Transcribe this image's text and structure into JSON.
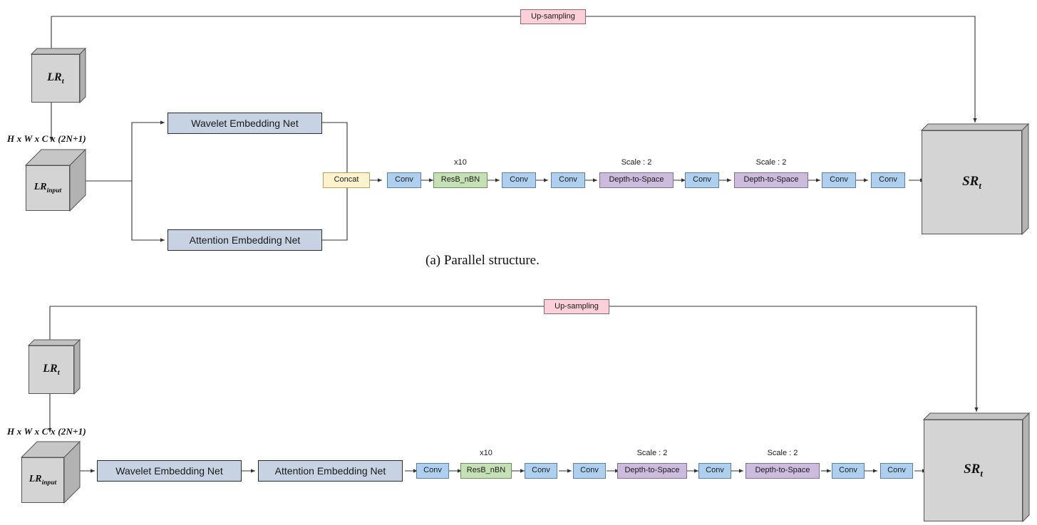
{
  "figure": {
    "caption_a": "(a) Parallel structure.",
    "dim_label": "H x W x C x (2N+1)"
  },
  "colors": {
    "embedding_net": "#c7d3e3",
    "conv": "#aed0ee",
    "resb": "#c5e0b4",
    "concat": "#fdf3ce",
    "depth_to_space": "#ccbbdd",
    "upsampling": "#fccfd9",
    "tensor": "#d4d4d4",
    "line": "#333333"
  },
  "labels": {
    "lr_t": "LR",
    "lr_t_sub": "t",
    "lr_input": "LR",
    "lr_input_sub": "input",
    "sr_t": "SR",
    "sr_t_sub": "t",
    "upsampling": "Up-sampling",
    "concat": "Concat",
    "conv": "Conv",
    "resb": "ResB_nBN",
    "depth_to_space": "Depth-to-Space",
    "wavelet_net": "Wavelet Embedding Net",
    "attention_net": "Attention Embedding Net",
    "resb_repeat": "x10",
    "scale": "Scale : 2"
  },
  "parallel_structure": {
    "branches": [
      {
        "label": "Wavelet Embedding Net"
      },
      {
        "label": "Attention Embedding Net"
      }
    ],
    "pipeline": [
      {
        "label": "Concat",
        "type": "concat",
        "anno": ""
      },
      {
        "label": "Conv",
        "type": "conv",
        "anno": ""
      },
      {
        "label": "ResB_nBN",
        "type": "resb",
        "anno": "x10"
      },
      {
        "label": "Conv",
        "type": "conv",
        "anno": ""
      },
      {
        "label": "Conv",
        "type": "conv",
        "anno": ""
      },
      {
        "label": "Depth-to-Space",
        "type": "d2s",
        "anno": "Scale : 2"
      },
      {
        "label": "Conv",
        "type": "conv",
        "anno": ""
      },
      {
        "label": "Depth-to-Space",
        "type": "d2s",
        "anno": "Scale : 2"
      },
      {
        "label": "Conv",
        "type": "conv",
        "anno": ""
      },
      {
        "label": "Conv",
        "type": "conv",
        "anno": ""
      }
    ]
  },
  "serial_structure": {
    "stages": [
      {
        "label": "Wavelet Embedding Net"
      },
      {
        "label": "Attention Embedding Net"
      }
    ],
    "pipeline": [
      {
        "label": "Conv",
        "type": "conv",
        "anno": ""
      },
      {
        "label": "ResB_nBN",
        "type": "resb",
        "anno": "x10"
      },
      {
        "label": "Conv",
        "type": "conv",
        "anno": ""
      },
      {
        "label": "Conv",
        "type": "conv",
        "anno": ""
      },
      {
        "label": "Depth-to-Space",
        "type": "d2s",
        "anno": "Scale : 2"
      },
      {
        "label": "Conv",
        "type": "conv",
        "anno": ""
      },
      {
        "label": "Depth-to-Space",
        "type": "d2s",
        "anno": "Scale : 2"
      },
      {
        "label": "Conv",
        "type": "conv",
        "anno": ""
      },
      {
        "label": "Conv",
        "type": "conv",
        "anno": ""
      }
    ]
  }
}
